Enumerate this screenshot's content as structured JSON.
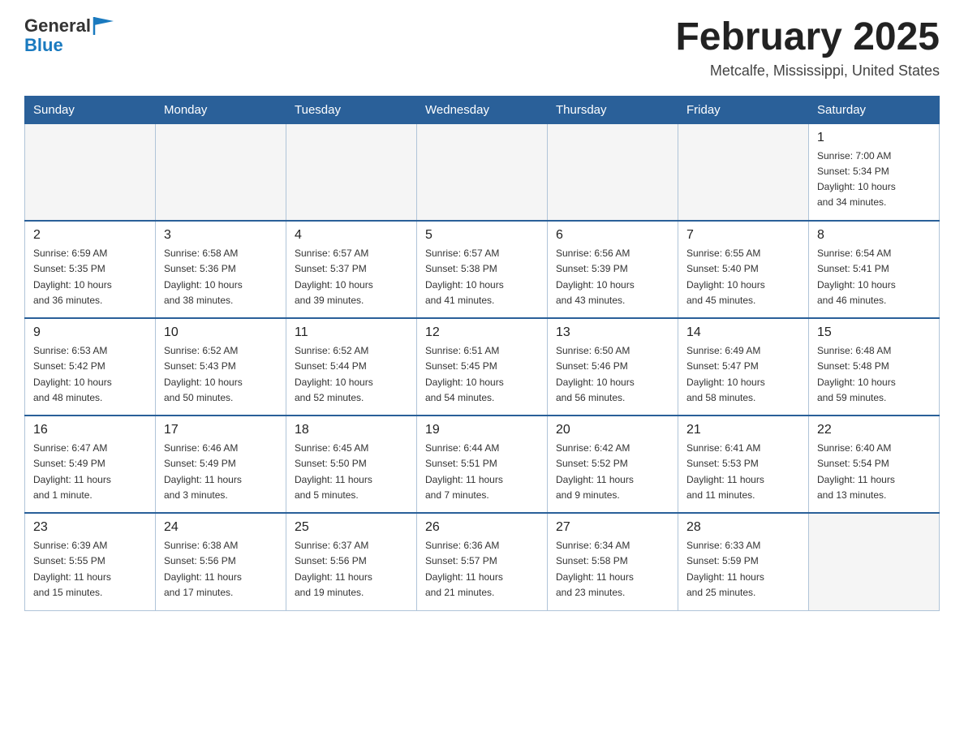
{
  "logo": {
    "general": "General",
    "blue": "Blue"
  },
  "title": "February 2025",
  "subtitle": "Metcalfe, Mississippi, United States",
  "days_of_week": [
    "Sunday",
    "Monday",
    "Tuesday",
    "Wednesday",
    "Thursday",
    "Friday",
    "Saturday"
  ],
  "weeks": [
    [
      {
        "day": "",
        "info": ""
      },
      {
        "day": "",
        "info": ""
      },
      {
        "day": "",
        "info": ""
      },
      {
        "day": "",
        "info": ""
      },
      {
        "day": "",
        "info": ""
      },
      {
        "day": "",
        "info": ""
      },
      {
        "day": "1",
        "info": "Sunrise: 7:00 AM\nSunset: 5:34 PM\nDaylight: 10 hours\nand 34 minutes."
      }
    ],
    [
      {
        "day": "2",
        "info": "Sunrise: 6:59 AM\nSunset: 5:35 PM\nDaylight: 10 hours\nand 36 minutes."
      },
      {
        "day": "3",
        "info": "Sunrise: 6:58 AM\nSunset: 5:36 PM\nDaylight: 10 hours\nand 38 minutes."
      },
      {
        "day": "4",
        "info": "Sunrise: 6:57 AM\nSunset: 5:37 PM\nDaylight: 10 hours\nand 39 minutes."
      },
      {
        "day": "5",
        "info": "Sunrise: 6:57 AM\nSunset: 5:38 PM\nDaylight: 10 hours\nand 41 minutes."
      },
      {
        "day": "6",
        "info": "Sunrise: 6:56 AM\nSunset: 5:39 PM\nDaylight: 10 hours\nand 43 minutes."
      },
      {
        "day": "7",
        "info": "Sunrise: 6:55 AM\nSunset: 5:40 PM\nDaylight: 10 hours\nand 45 minutes."
      },
      {
        "day": "8",
        "info": "Sunrise: 6:54 AM\nSunset: 5:41 PM\nDaylight: 10 hours\nand 46 minutes."
      }
    ],
    [
      {
        "day": "9",
        "info": "Sunrise: 6:53 AM\nSunset: 5:42 PM\nDaylight: 10 hours\nand 48 minutes."
      },
      {
        "day": "10",
        "info": "Sunrise: 6:52 AM\nSunset: 5:43 PM\nDaylight: 10 hours\nand 50 minutes."
      },
      {
        "day": "11",
        "info": "Sunrise: 6:52 AM\nSunset: 5:44 PM\nDaylight: 10 hours\nand 52 minutes."
      },
      {
        "day": "12",
        "info": "Sunrise: 6:51 AM\nSunset: 5:45 PM\nDaylight: 10 hours\nand 54 minutes."
      },
      {
        "day": "13",
        "info": "Sunrise: 6:50 AM\nSunset: 5:46 PM\nDaylight: 10 hours\nand 56 minutes."
      },
      {
        "day": "14",
        "info": "Sunrise: 6:49 AM\nSunset: 5:47 PM\nDaylight: 10 hours\nand 58 minutes."
      },
      {
        "day": "15",
        "info": "Sunrise: 6:48 AM\nSunset: 5:48 PM\nDaylight: 10 hours\nand 59 minutes."
      }
    ],
    [
      {
        "day": "16",
        "info": "Sunrise: 6:47 AM\nSunset: 5:49 PM\nDaylight: 11 hours\nand 1 minute."
      },
      {
        "day": "17",
        "info": "Sunrise: 6:46 AM\nSunset: 5:49 PM\nDaylight: 11 hours\nand 3 minutes."
      },
      {
        "day": "18",
        "info": "Sunrise: 6:45 AM\nSunset: 5:50 PM\nDaylight: 11 hours\nand 5 minutes."
      },
      {
        "day": "19",
        "info": "Sunrise: 6:44 AM\nSunset: 5:51 PM\nDaylight: 11 hours\nand 7 minutes."
      },
      {
        "day": "20",
        "info": "Sunrise: 6:42 AM\nSunset: 5:52 PM\nDaylight: 11 hours\nand 9 minutes."
      },
      {
        "day": "21",
        "info": "Sunrise: 6:41 AM\nSunset: 5:53 PM\nDaylight: 11 hours\nand 11 minutes."
      },
      {
        "day": "22",
        "info": "Sunrise: 6:40 AM\nSunset: 5:54 PM\nDaylight: 11 hours\nand 13 minutes."
      }
    ],
    [
      {
        "day": "23",
        "info": "Sunrise: 6:39 AM\nSunset: 5:55 PM\nDaylight: 11 hours\nand 15 minutes."
      },
      {
        "day": "24",
        "info": "Sunrise: 6:38 AM\nSunset: 5:56 PM\nDaylight: 11 hours\nand 17 minutes."
      },
      {
        "day": "25",
        "info": "Sunrise: 6:37 AM\nSunset: 5:56 PM\nDaylight: 11 hours\nand 19 minutes."
      },
      {
        "day": "26",
        "info": "Sunrise: 6:36 AM\nSunset: 5:57 PM\nDaylight: 11 hours\nand 21 minutes."
      },
      {
        "day": "27",
        "info": "Sunrise: 6:34 AM\nSunset: 5:58 PM\nDaylight: 11 hours\nand 23 minutes."
      },
      {
        "day": "28",
        "info": "Sunrise: 6:33 AM\nSunset: 5:59 PM\nDaylight: 11 hours\nand 25 minutes."
      },
      {
        "day": "",
        "info": ""
      }
    ]
  ]
}
